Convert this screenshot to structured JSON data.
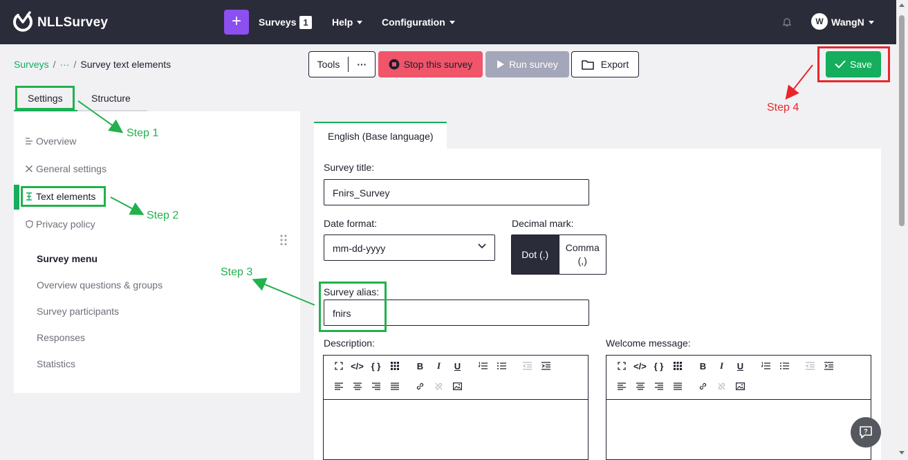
{
  "navbar": {
    "logo_text": "NLLSurvey",
    "plus_label": "+",
    "surveys_label": "Surveys",
    "surveys_count": "1",
    "help_label": "Help",
    "config_label": "Configuration",
    "avatar_initial": "W",
    "username": "WangN"
  },
  "breadcrumb": {
    "root": "Surveys",
    "ellipsis": "···",
    "current": "Survey text elements"
  },
  "toolbar": {
    "tools_label": "Tools",
    "tools_more": "···",
    "stop_label": "Stop this survey",
    "run_label": "Run survey",
    "export_label": "Export",
    "save_label": "Save"
  },
  "left_tabs": {
    "settings": "Settings",
    "structure": "Structure"
  },
  "sidebar": {
    "items": [
      {
        "label": "Overview",
        "icon": "list-icon"
      },
      {
        "label": "General settings",
        "icon": "tools-icon"
      },
      {
        "label": "Text elements",
        "icon": "text-cursor-icon"
      },
      {
        "label": "Privacy policy",
        "icon": "shield-icon"
      }
    ],
    "menu_title": "Survey menu",
    "menu_items": [
      "Overview questions & groups",
      "Survey participants",
      "Responses",
      "Statistics"
    ]
  },
  "content": {
    "lang_tab": "English (Base language)",
    "survey_title_label": "Survey title:",
    "survey_title_value": "Fnirs_Survey",
    "date_format_label": "Date format:",
    "date_format_value": "mm-dd-yyyy",
    "decimal_label": "Decimal mark:",
    "decimal_options": [
      "Dot (.)",
      "Comma (,)"
    ],
    "decimal_selected": "Dot (.)",
    "alias_label": "Survey alias:",
    "alias_value": "fnirs",
    "description_label": "Description:",
    "welcome_label": "Welcome message:"
  },
  "editor_toolbar": {
    "row1": [
      "fullscreen-icon",
      "code-icon",
      "braces-icon",
      "grid-icon",
      "B",
      "I",
      "U",
      "ordered-list-icon",
      "bullet-list-icon",
      "outdent-icon",
      "indent-icon"
    ],
    "row2": [
      "align-left-icon",
      "align-center-icon",
      "align-right-icon",
      "justify-icon",
      "link-icon",
      "unlink-icon",
      "image-icon"
    ]
  },
  "annotations": {
    "step1": "Step 1",
    "step2": "Step 2",
    "step3": "Step 3",
    "step4": "Step 4"
  },
  "colors": {
    "navbar": "#2b2c39",
    "accent_green": "#14ae5c",
    "stop_red": "#f0556a",
    "run_gray": "#a4a7b9",
    "plus_purple": "#8c4ff0",
    "annotation_green": "#22b14c",
    "annotation_red": "#e8262a"
  }
}
